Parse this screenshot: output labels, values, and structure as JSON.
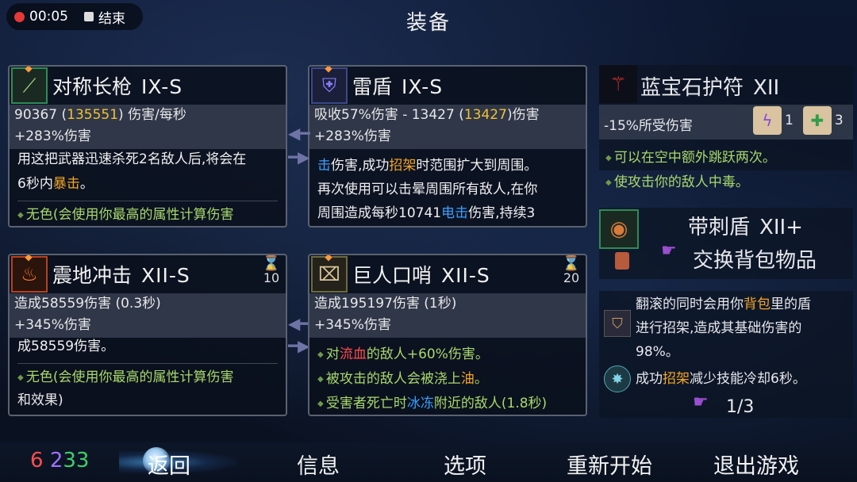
{
  "recording": {
    "time": "00:05",
    "stop_label": "结束"
  },
  "title": "装备",
  "cards": {
    "spear": {
      "icon": "spear-icon",
      "name": "对称长枪",
      "tier": "IX-S",
      "stat_main": "90367",
      "stat_paren": "135551",
      "stat_unit": "伤害/每秒",
      "stat_sub": "+283%伤害",
      "desc_1a": "用这把武器迅速杀死2名敌人后,将会在",
      "desc_2a": "6秒内",
      "desc_2b": "暴击",
      "desc_2c": "。",
      "bullet": "无色(会使用你最高的属性计算伤害"
    },
    "thunder_shield": {
      "icon": "shield-icon",
      "name": "雷盾",
      "tier": "IX-S",
      "stat_main": "吸收57%伤害 - 13427",
      "stat_paren": "13427",
      "stat_unit": "伤害",
      "stat_sub": "+283%伤害",
      "l1a": "击",
      "l1b": "伤害,成功",
      "l1c": "招架",
      "l1d": "时范围扩大到周围。",
      "l2": "再次使用可以击晕周围所有敌人,在你",
      "l3a": "周围造成每秒10741",
      "l3b": "电击",
      "l3c": "伤害,持续3"
    },
    "quake": {
      "icon": "quake-icon",
      "name": "震地冲击",
      "tier": "XII-S",
      "cooldown": "10",
      "stat_main": "造成58559伤害 (0.3秒)",
      "stat_sub": "+345%伤害",
      "desc_1": "成58559伤害。",
      "bullet_1": "无色(会使用你最高的属性计算伤害",
      "bullet_1b": "和效果)"
    },
    "whistle": {
      "icon": "whistle-icon",
      "name": "巨人口哨",
      "tier": "XII-S",
      "cooldown": "20",
      "stat_main": "造成195197伤害 (1秒)",
      "stat_sub": "+345%伤害",
      "b1a": "对",
      "b1b": "流血",
      "b1c": "的敌人+60%伤害。",
      "b2a": "被攻击的敌人会被浇上",
      "b2b": "油",
      "b2c": "。",
      "b3a": "受害者死亡时",
      "b3b": "冰冻",
      "b3c": "附近的敌人(1.8秒)"
    }
  },
  "amulet": {
    "icon": "wand-amulet-icon",
    "name": "蓝宝石护符",
    "tier": "XII",
    "stat": "-15%所受伤害",
    "scroll_1_count": "1",
    "scroll_2_count": "3",
    "bullet_1": "可以在空中额外跳跃两次。",
    "bullet_2": "使攻击你的敌人中毒。"
  },
  "spike_shield": {
    "name": "带刺盾",
    "tier": "XII+",
    "action": "交换背包物品"
  },
  "skill_info": {
    "line1a": "翻滚的同时会用你",
    "line1b": "背包",
    "line1c": "里的盾",
    "line2": "进行招架,造成其基础伤害的",
    "line3": "98%。",
    "line4a": "成功",
    "line4b": "招架",
    "line4c": "减少技能冷却6秒。",
    "page": "1/3"
  },
  "scrolls": {
    "red": "6",
    "purple": "2",
    "green": "33"
  },
  "nav": {
    "back": "返回",
    "info": "信息",
    "options": "选项",
    "restart": "重新开始",
    "quit": "退出游戏"
  },
  "colors": {
    "brutality": "#ff4d4d",
    "tactics": "#a070ff",
    "survival": "#3ecf6a",
    "gold": "#f2c132"
  }
}
